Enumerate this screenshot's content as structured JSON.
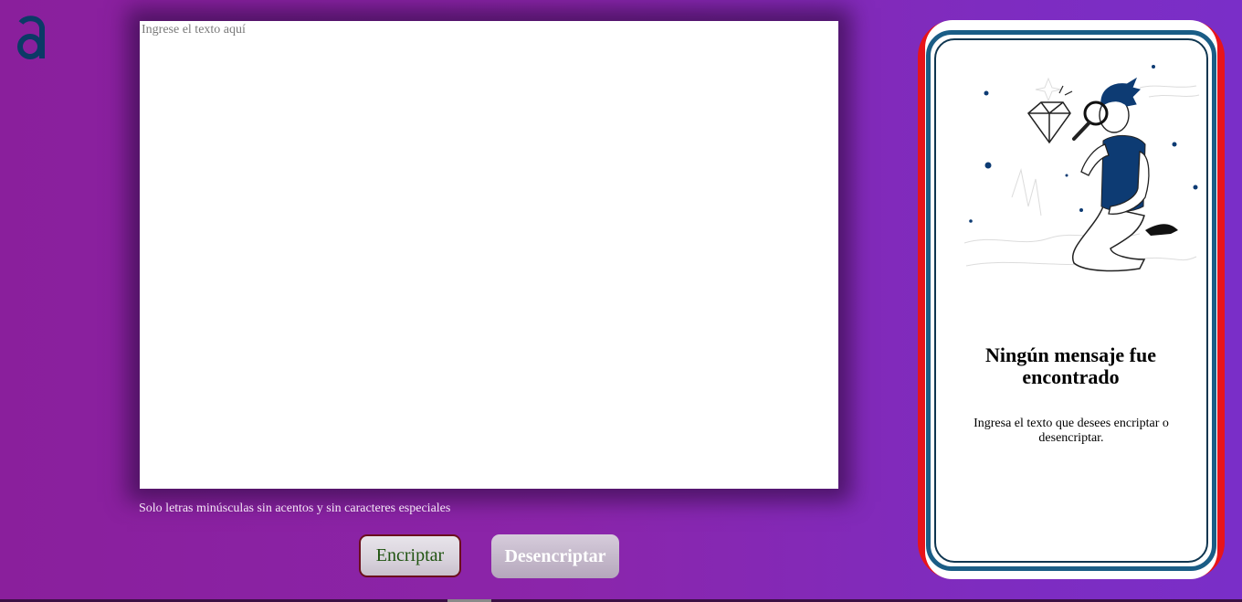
{
  "logo": {
    "icon": "alura-a-logo-icon",
    "color": "#0b3a66"
  },
  "input": {
    "placeholder": "Ingrese el texto aquí",
    "value": ""
  },
  "hint": "Solo letras minúsculas sin acentos y sin caracteres especiales",
  "buttons": {
    "encrypt": "Encriptar",
    "decrypt": "Desencriptar"
  },
  "output": {
    "illustration_icon": "person-with-magnifying-glass-icon",
    "title": "Ningún mensaje fue encontrado",
    "text": "Ingresa el texto que desees encriptar o desencriptar."
  },
  "colors": {
    "background": "#8a24a6",
    "card_border": "#1a5d86",
    "card_accent": "#e8141a",
    "encrypt_border": "#6b0f1d",
    "encrypt_text": "#1f5310"
  }
}
